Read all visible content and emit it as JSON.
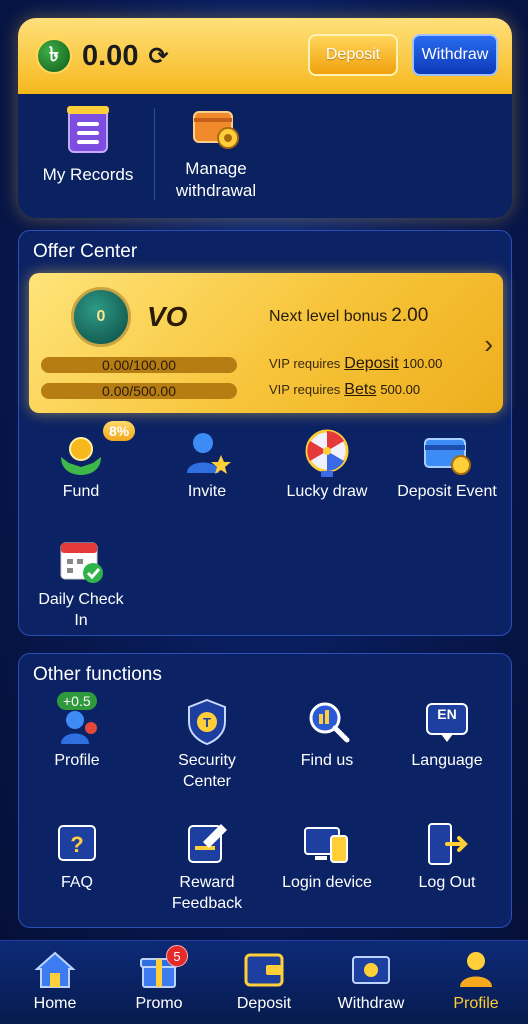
{
  "wallet": {
    "balance": "0.00",
    "currency_symbol": "৳",
    "deposit_label": "Deposit",
    "withdraw_label": "Withdraw"
  },
  "records": [
    {
      "label": "My Records",
      "icon": "records-icon"
    },
    {
      "label": "Manage withdrawal",
      "icon": "wallet-settings-icon"
    }
  ],
  "offer_center": {
    "title": "Offer Center",
    "vip": {
      "badge": "0",
      "level": "VO",
      "next_label": "Next level bonus",
      "next_value": "2.00",
      "deposit_progress": "0.00/100.00",
      "bets_progress": "0.00/500.00",
      "req_prefix": "VIP requires",
      "deposit_link": "Deposit",
      "deposit_req": "100.00",
      "bets_link": "Bets",
      "bets_req": "500.00"
    },
    "items": [
      {
        "label": "Fund",
        "badge": "8%"
      },
      {
        "label": "Invite"
      },
      {
        "label": "Lucky draw"
      },
      {
        "label": "Deposit Event"
      },
      {
        "label": "Daily Check In"
      }
    ]
  },
  "other_functions": {
    "title": "Other functions",
    "items": [
      {
        "label": "Profile",
        "badge": "+0.5"
      },
      {
        "label": "Security Center"
      },
      {
        "label": "Find us"
      },
      {
        "label": "Language",
        "icon_text": "EN"
      },
      {
        "label": "FAQ"
      },
      {
        "label": "Reward Feedback"
      },
      {
        "label": "Login device"
      },
      {
        "label": "Log Out"
      }
    ]
  },
  "nav": {
    "items": [
      {
        "label": "Home"
      },
      {
        "label": "Promo",
        "badge": "5"
      },
      {
        "label": "Deposit"
      },
      {
        "label": "Withdraw"
      },
      {
        "label": "Profile",
        "active": true
      }
    ]
  },
  "colors": {
    "accent": "#f6b81d",
    "nav_active": "#ffcc33",
    "background": "#081a55"
  }
}
